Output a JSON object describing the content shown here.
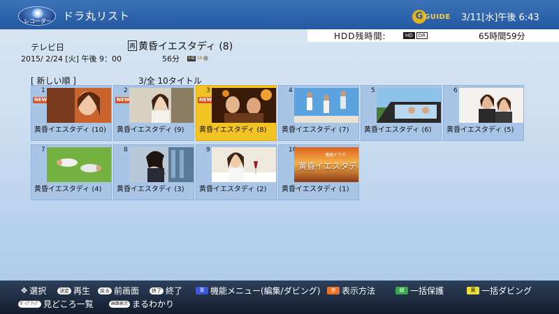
{
  "header": {
    "logo_text": "レコーダー",
    "title": "ドラ丸リスト",
    "guide_letter": "G",
    "guide_text": "GUIDE",
    "clock": "3/11[水]午後 6:43"
  },
  "hdd": {
    "label": "HDD残時間:",
    "tag_a": "HD",
    "tag_b": "DR",
    "value": "65時間59分"
  },
  "program": {
    "channel": "テレビ日",
    "title_mark": "再",
    "title": "黄昏イエスタディ (8)",
    "datetime": "2015/ 2/24 [火]  午後 9：00",
    "duration": "56分",
    "rec_tag": "5倍",
    "rec_tag2": "10"
  },
  "list": {
    "sort": "[  新しい順  ]",
    "count": "3/全  10タイトル",
    "new_label": "NEW",
    "items": [
      {
        "num": "1",
        "caption": "黄昏イエスタディ (10)",
        "new": true
      },
      {
        "num": "2",
        "caption": "黄昏イエスタディ (9)",
        "new": true
      },
      {
        "num": "3",
        "caption": "黄昏イエスタディ (8)",
        "new": true,
        "selected": true
      },
      {
        "num": "4",
        "caption": "黄昏イエスタディ (7)"
      },
      {
        "num": "5",
        "caption": "黄昏イエスタディ (6)"
      },
      {
        "num": "6",
        "caption": "黄昏イエスタディ (5)"
      },
      {
        "num": "7",
        "caption": "黄昏イエスタディ (4)"
      },
      {
        "num": "8",
        "caption": "黄昏イエスタディ (3)"
      },
      {
        "num": "9",
        "caption": "黄昏イエスタディ (2)"
      },
      {
        "num": "10",
        "caption": "黄昏イエスタディ (1)",
        "thumb_text_small": "連続ドラマ",
        "thumb_text": "黄昏イエスタディ"
      }
    ]
  },
  "footer": {
    "select": "選択",
    "enter_key": "決定",
    "enter": "再生",
    "back_key": "戻る",
    "back": "前画面",
    "end_key": "終了",
    "end": "終了",
    "blue_key": "青",
    "blue": "機能メニュー(編集/ダビング)",
    "red_key": "赤",
    "red": "表示方法",
    "green_key": "緑",
    "green": "一括保護",
    "yellow_key": "黄",
    "yellow": "一括ダビング",
    "popup_key": "ﾎﾟｯﾌﾟｱｯﾌﾟ",
    "popup": "見どころ一覧",
    "display_key": "画面表示",
    "display": "まるわかり"
  }
}
